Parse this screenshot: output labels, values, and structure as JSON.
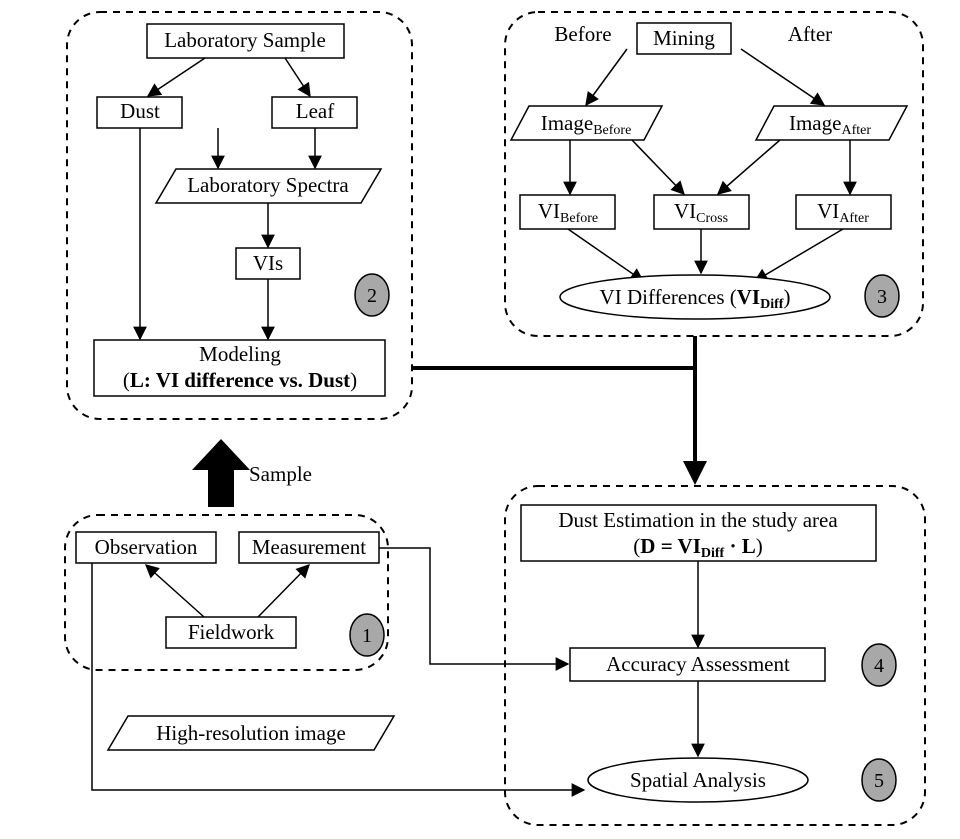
{
  "panel1": {
    "badge": "1",
    "fieldwork": "Fieldwork",
    "observation": "Observation",
    "measurement": "Measurement"
  },
  "panel2": {
    "badge": "2",
    "lab_sample": "Laboratory Sample",
    "dust": "Dust",
    "leaf": "Leaf",
    "lab_spectra": "Laboratory Spectra",
    "vis": "VIs",
    "modeling_line1": "Modeling",
    "modeling_line2_a": "(",
    "modeling_line2_b": "L: VI difference vs. Dust",
    "modeling_line2_c": ")"
  },
  "panel3": {
    "badge": "3",
    "before": "Before",
    "after": "After",
    "mining": "Mining",
    "image_before_a": "Image",
    "image_before_b": "Before",
    "image_after_a": "Image",
    "image_after_b": "After",
    "vi_before_a": "VI",
    "vi_before_b": "Before",
    "vi_cross_a": "VI",
    "vi_cross_b": "Cross",
    "vi_after_a": "VI",
    "vi_after_b": "After",
    "vi_diff_a": "VI Differences (",
    "vi_diff_b": "VI",
    "vi_diff_c": "Diff",
    "vi_diff_d": ")"
  },
  "panel4": {
    "badge": "4",
    "dust_est_line1": "Dust Estimation in the study area",
    "dust_est_a": "(",
    "dust_est_b": "D = VI",
    "dust_est_c": "Diff",
    "dust_est_d": " · L",
    "dust_est_e": ")",
    "accuracy": "Accuracy Assessment"
  },
  "panel5": {
    "badge": "5",
    "spatial": "Spatial Analysis"
  },
  "misc": {
    "sample": "Sample",
    "highres": "High-resolution image"
  }
}
